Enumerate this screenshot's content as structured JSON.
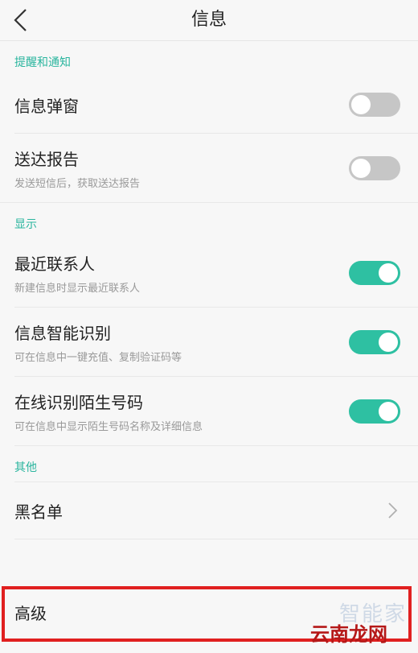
{
  "header": {
    "title": "信息"
  },
  "sections": [
    {
      "title": "提醒和通知",
      "items": [
        {
          "label": "信息弹窗",
          "sub": "",
          "state": "off"
        },
        {
          "label": "送达报告",
          "sub": "发送短信后，获取送达报告",
          "state": "off"
        }
      ]
    },
    {
      "title": "显示",
      "items": [
        {
          "label": "最近联系人",
          "sub": "新建信息时显示最近联系人",
          "state": "on"
        },
        {
          "label": "信息智能识别",
          "sub": "可在信息中一键充值、复制验证码等",
          "state": "on"
        },
        {
          "label": "在线识别陌生号码",
          "sub": "可在信息中显示陌生号码名称及详细信息",
          "state": "on"
        }
      ]
    },
    {
      "title": "其他",
      "items": [
        {
          "label": "黑名单"
        },
        {
          "label": "高级"
        }
      ]
    }
  ],
  "watermark": {
    "text1": "智能家",
    "text2": "云南龙网"
  },
  "colors": {
    "accent": "#2ec0a2",
    "section_title": "#2ab59e",
    "highlight": "#e02020"
  }
}
